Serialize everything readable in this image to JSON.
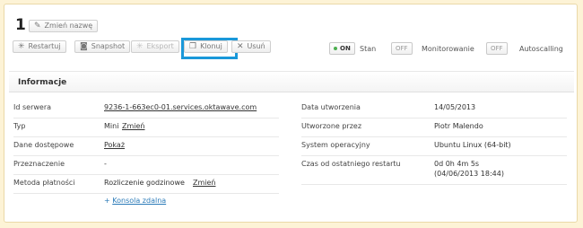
{
  "server": {
    "number": "1",
    "rename_label": "Zmień nazwę"
  },
  "toolbar": {
    "restart": "Restartuj",
    "snapshot": "Snapshot",
    "export": "Eksport",
    "clone": "Klonuj",
    "delete": "Usuń"
  },
  "toggles": {
    "state": {
      "value": "ON",
      "label": "Stan"
    },
    "monitoring": {
      "value": "OFF",
      "label": "Monitorowanie"
    },
    "autoscaling": {
      "value": "OFF",
      "label": "Autoscalling"
    }
  },
  "info": {
    "title": "Informacje",
    "left": {
      "server_id_label": "Id serwera",
      "server_id_value": "9236-1-663ec0-01.services.oktawave.com",
      "type_label": "Typ",
      "type_value": "Mini",
      "type_change": "Zmień",
      "access_label": "Dane dostępowe",
      "access_link": "Pokaż",
      "purpose_label": "Przeznaczenie",
      "purpose_value": "-",
      "payment_label": "Metoda płatności",
      "payment_value": "Rozliczenie godzinowe",
      "payment_change": "Zmień",
      "console_link": "Konsola zdalna"
    },
    "right": {
      "created_label": "Data utworzenia",
      "created_value": "14/05/2013",
      "created_by_label": "Utworzone przez",
      "created_by_value": "Piotr Malendo",
      "os_label": "System operacyjny",
      "os_value": "Ubuntu Linux (64-bit)",
      "uptime_label": "Czas od ostatniego restartu",
      "uptime_value": "0d 0h 4m 5s",
      "uptime_since": "(04/06/2013 18:44)"
    }
  }
}
